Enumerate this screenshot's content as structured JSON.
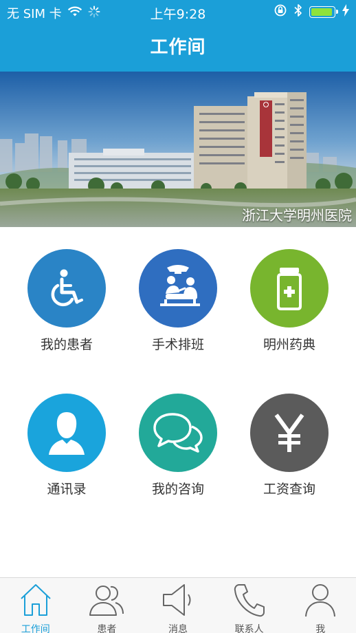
{
  "status_bar": {
    "carrier": "无 SIM 卡",
    "time": "上午9:28",
    "battery_level": 0.95
  },
  "header": {
    "title": "工作间"
  },
  "banner": {
    "caption": "浙江大学明州医院"
  },
  "grid": [
    {
      "label": "我的患者",
      "icon": "wheelchair-icon",
      "color": "#2a84c6"
    },
    {
      "label": "手术排班",
      "icon": "surgery-icon",
      "color": "#2f6ec0"
    },
    {
      "label": "明州药典",
      "icon": "medicine-bottle-icon",
      "color": "#78b52e"
    },
    {
      "label": "通讯录",
      "icon": "contact-person-icon",
      "color": "#1aa4dc"
    },
    {
      "label": "我的咨询",
      "icon": "chat-bubbles-icon",
      "color": "#22a999"
    },
    {
      "label": "工资查询",
      "icon": "yen-icon",
      "color": "#5b5b5b"
    }
  ],
  "tabbar": {
    "accent": "#1b9fd8",
    "tabs": [
      {
        "label": "工作间",
        "icon": "home-icon",
        "active": true
      },
      {
        "label": "患者",
        "icon": "patients-icon",
        "active": false
      },
      {
        "label": "消息",
        "icon": "speaker-icon",
        "active": false
      },
      {
        "label": "联系人",
        "icon": "phone-icon",
        "active": false
      },
      {
        "label": "我",
        "icon": "user-icon",
        "active": false
      }
    ]
  }
}
